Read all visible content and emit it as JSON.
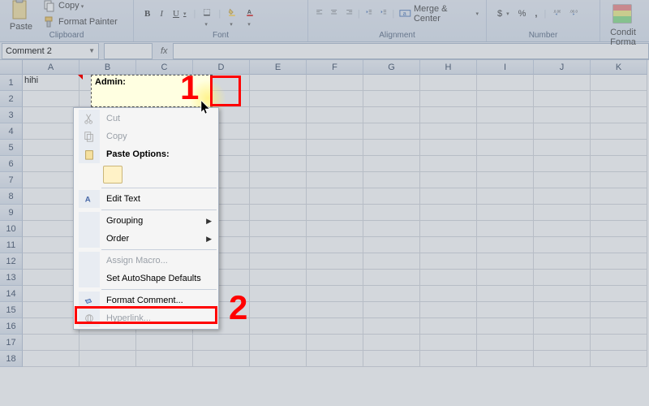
{
  "ribbon": {
    "clipboard": {
      "label": "Clipboard",
      "paste": "Paste",
      "copy": "Copy",
      "format_painter": "Format Painter"
    },
    "font": {
      "label": "Font",
      "bold": "B",
      "italic": "I",
      "underline": "U"
    },
    "alignment": {
      "label": "Alignment",
      "merge": "Merge & Center"
    },
    "number": {
      "label": "Number",
      "currency": "$",
      "percent": "%",
      "comma": ","
    },
    "styles": {
      "conditional": "Condit",
      "formatting": "Forma"
    }
  },
  "formula_bar": {
    "name_box": "Comment 2",
    "fx": "fx"
  },
  "columns": [
    "A",
    "B",
    "C",
    "D",
    "E",
    "F",
    "G",
    "H",
    "I",
    "J",
    "K"
  ],
  "rows": [
    "1",
    "2",
    "3",
    "4",
    "5",
    "6",
    "7",
    "8",
    "9",
    "10",
    "11",
    "12",
    "13",
    "14",
    "15",
    "16",
    "17",
    "18"
  ],
  "cell_a1": "hihi",
  "comment": {
    "author": "Admin:"
  },
  "context_menu": {
    "cut": "Cut",
    "copy": "Copy",
    "paste_options": "Paste Options:",
    "edit_text": "Edit Text",
    "grouping": "Grouping",
    "order": "Order",
    "assign_macro": "Assign Macro...",
    "set_autoshape": "Set AutoShape Defaults",
    "format_comment": "Format Comment...",
    "hyperlink": "Hyperlink..."
  },
  "annotations": {
    "one": "1",
    "two": "2"
  }
}
